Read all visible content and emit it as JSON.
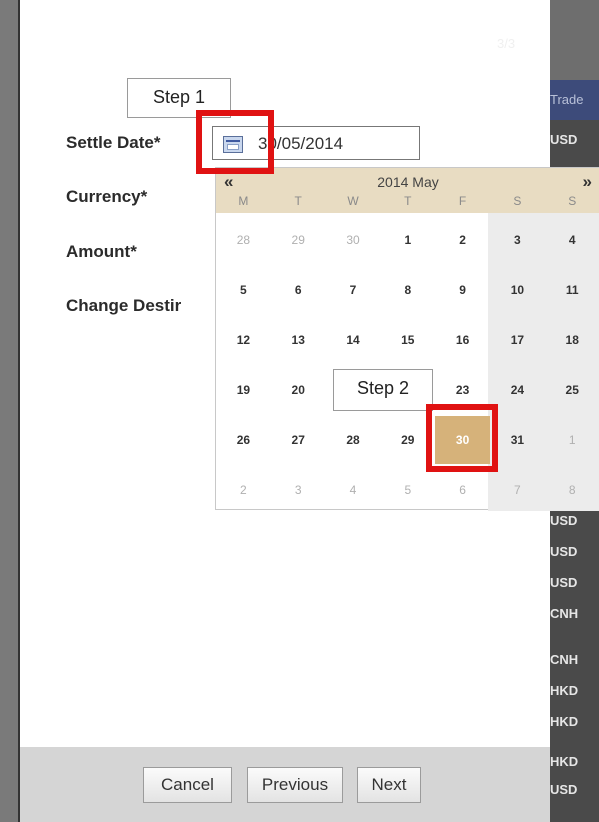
{
  "background_table": {
    "header_label": "Trade",
    "currencies_top": [
      "USD"
    ],
    "currencies_bottom": [
      "USD",
      "USD",
      "USD",
      "CNH",
      "CNH",
      "HKD",
      "HKD",
      "HKD",
      "USD"
    ]
  },
  "dialog": {
    "title": "",
    "subtitle": "",
    "page_indicator": "3/3"
  },
  "annotations": {
    "step1": "Step 1",
    "step2": "Step 2",
    "highlight_color": "#e01212"
  },
  "form": {
    "settle_date_label": "Settle Date*",
    "settle_date_value": "30/05/2014",
    "currency_label": "Currency*",
    "amount_label": "Amount*",
    "change_destination_label": "Change Destir"
  },
  "calendar": {
    "prev_label": "«",
    "next_label": "»",
    "month_label": "2014 May",
    "weekdays": [
      "M",
      "T",
      "W",
      "T",
      "F",
      "S",
      "S"
    ],
    "weeks": [
      [
        "28",
        "29",
        "30",
        "1",
        "2",
        "3",
        "4"
      ],
      [
        "5",
        "6",
        "7",
        "8",
        "9",
        "10",
        "11"
      ],
      [
        "12",
        "13",
        "14",
        "15",
        "16",
        "17",
        "18"
      ],
      [
        "19",
        "20",
        "21",
        "22",
        "23",
        "24",
        "25"
      ],
      [
        "26",
        "27",
        "28",
        "29",
        "30",
        "31",
        "1"
      ],
      [
        "2",
        "3",
        "4",
        "5",
        "6",
        "7",
        "8"
      ]
    ],
    "selected_day": "30",
    "selected_color": "#d6b27a"
  },
  "footer": {
    "cancel_label": "Cancel",
    "previous_label": "Previous",
    "next_label": "Next"
  }
}
